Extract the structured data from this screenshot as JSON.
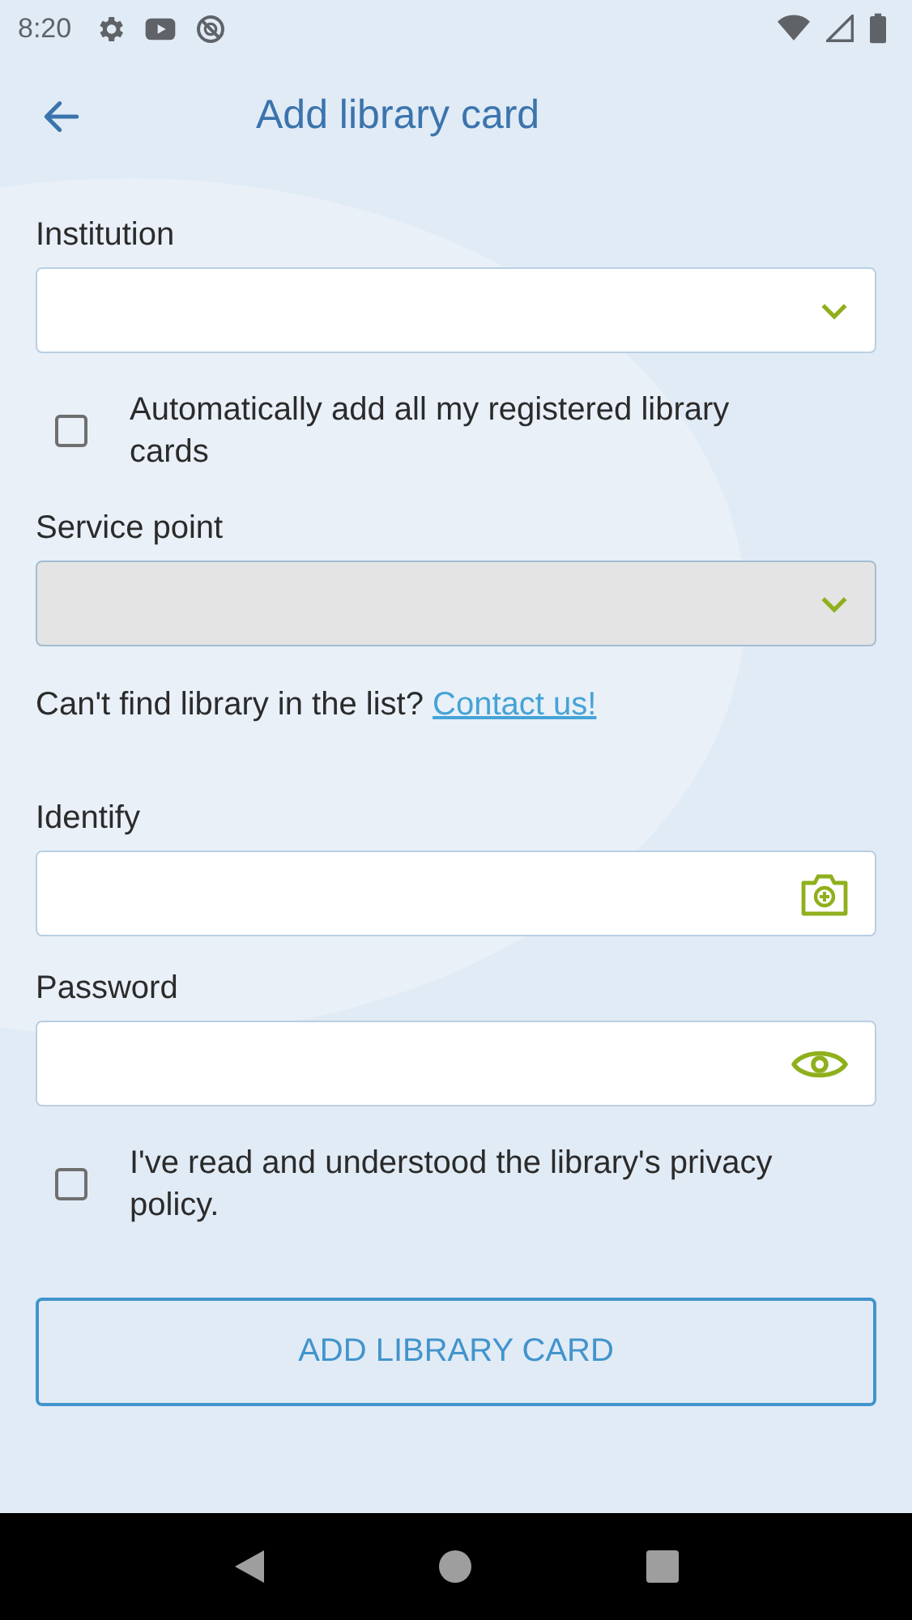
{
  "status_bar": {
    "time": "8:20"
  },
  "app_bar": {
    "title": "Add library card"
  },
  "form": [
    {
      "kind": "dropdown",
      "label": "Institution",
      "disabled": false
    },
    {
      "kind": "checkbox",
      "label": "Automatically add all my registered library cards",
      "checked": false
    },
    {
      "kind": "dropdown",
      "label": "Service point",
      "disabled": true
    },
    {
      "kind": "note",
      "text": "Can't find library in the list?",
      "link": "Contact us!"
    },
    {
      "kind": "scan_field",
      "label": "Identify",
      "disabled": false
    },
    {
      "kind": "password_field",
      "label": "Password",
      "disabled": false
    },
    {
      "kind": "checkbox",
      "label": "I've read and understood the library's privacy policy.",
      "checked": false
    },
    {
      "kind": "button",
      "label": "ADD LIBRARY CARD"
    }
  ]
}
